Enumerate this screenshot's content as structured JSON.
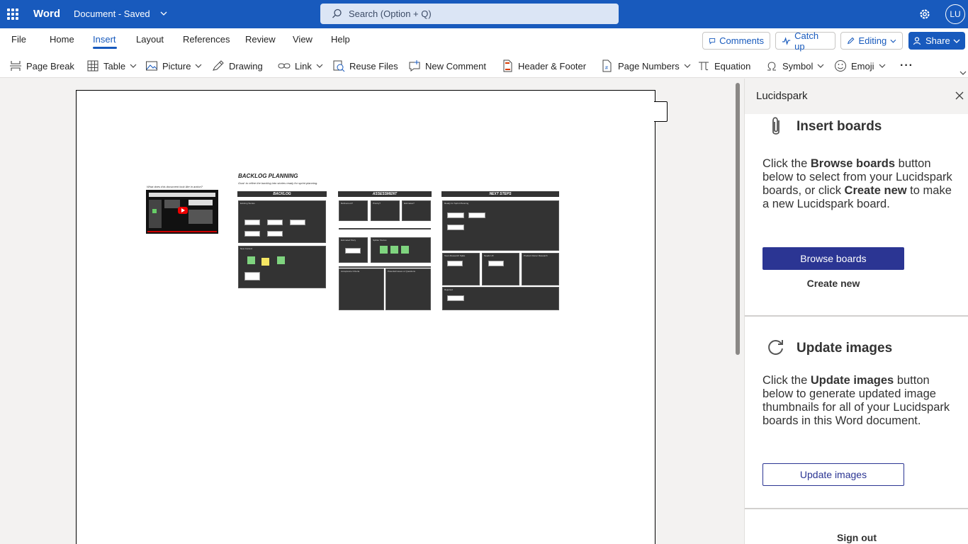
{
  "titlebar": {
    "app_name": "Word",
    "doc_title": "Document - Saved",
    "search_placeholder": "Search (Option + Q)",
    "avatar_initials": "LU"
  },
  "menu": {
    "items": [
      "File",
      "Home",
      "Insert",
      "Layout",
      "References",
      "Review",
      "View",
      "Help"
    ],
    "active": "Insert",
    "comments": "Comments",
    "catch_up": "Catch up",
    "editing": "Editing",
    "share": "Share"
  },
  "ribbon": {
    "page_break": "Page Break",
    "table": "Table",
    "picture": "Picture",
    "drawing": "Drawing",
    "link": "Link",
    "reuse_files": "Reuse Files",
    "new_comment": "New Comment",
    "header_footer": "Header & Footer",
    "page_numbers": "Page Numbers",
    "equation": "Equation",
    "symbol": "Symbol",
    "emoji": "Emoji",
    "more": "···"
  },
  "board": {
    "video_caption": "What does this document look like in action?",
    "title": "BACKLOG PLANNING",
    "goal": "Goal: to refine the backlog into stories ready for sprint planning.",
    "bands": [
      "BACKLOG",
      "ASSESSMENT",
      "NEXT STEPS"
    ],
    "labels": {
      "existing": "Existing Stories",
      "new_ideas": "New Context",
      "refinement": "Refinement?",
      "priority": "Priority?",
      "estimates": "Estimates?",
      "story_sizes": "Estimated Story",
      "splitter": "Splitter Stories",
      "acceptance": "Acceptance Criteria",
      "potential": "Potential Issues or Questions",
      "ready_sprint": "Ready for Sprint Planning",
      "research": "Team Research Spike",
      "needs_ux": "Needs UX",
      "product": "Product Owner Research",
      "rejected": "Rejected"
    }
  },
  "pane": {
    "title": "Lucidspark",
    "insert_heading": "Insert boards",
    "insert_text_1": "Click the ",
    "insert_bold_1": "Browse boards",
    "insert_text_2": " button below to select from your Lucidspark boards, or click ",
    "insert_bold_2": "Create new",
    "insert_text_3": " to make a new Lucidspark board.",
    "browse_button": "Browse boards",
    "create_new": "Create new",
    "update_heading": "Update images",
    "update_text_1": "Click the ",
    "update_bold_1": "Update images",
    "update_text_2": " button below to generate updated image thumbnails for all of your Lucidspark boards in this Word document.",
    "update_button": "Update images",
    "sign_out": "Sign out"
  },
  "colors": {
    "brand": "#185abd",
    "pane_primary": "#2b3593",
    "board_dark": "#333333",
    "sticky_green": "#7fd47f",
    "sticky_yellow": "#f5e663"
  }
}
